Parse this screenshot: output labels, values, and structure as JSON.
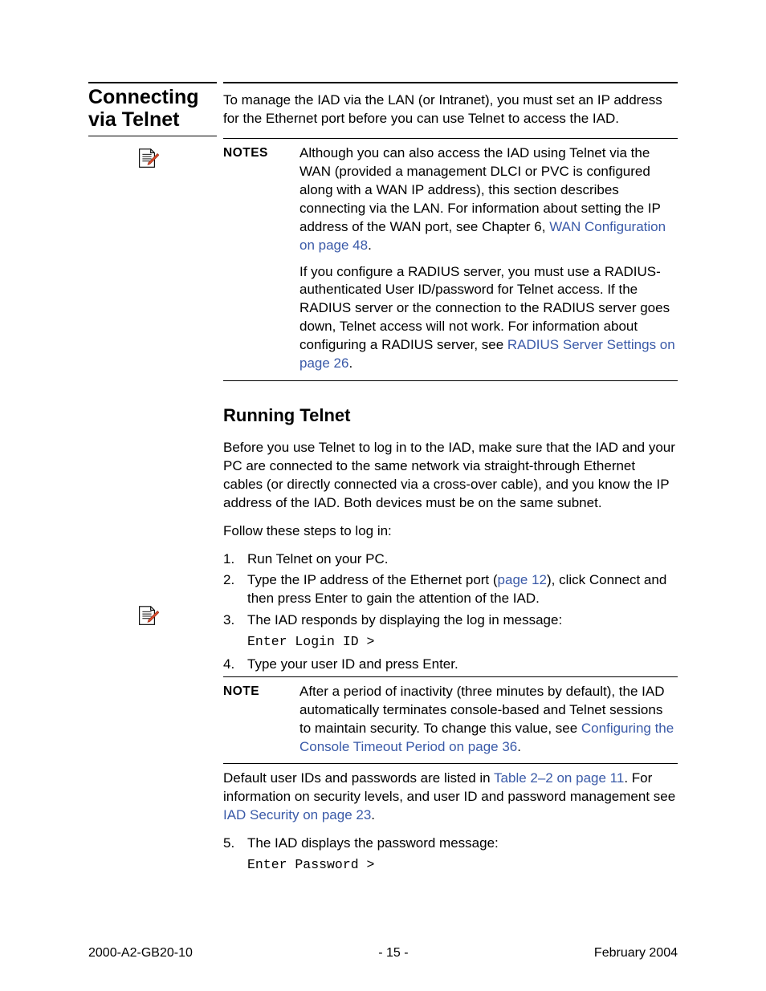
{
  "section_title": "Connecting via Telnet",
  "intro": "To manage the IAD via the LAN (or Intranet), you must set an IP address for the Ethernet port before you can use Telnet to access the IAD.",
  "notes_label": "NOTES",
  "notes": {
    "p1a": "Although you can also access the IAD using Telnet via the WAN (provided a management DLCI or PVC is configured along with a WAN IP address), this section describes connecting via the LAN. For information about setting the IP address of the WAN port, see Chapter 6, ",
    "p1x": "WAN Configuration on page 48",
    "p1b": ".",
    "p2a": "If you configure a RADIUS server, you must use a RADIUS-authenticated User ID/password for Telnet access. If the RADIUS server or the connection to the RADIUS server goes down, Telnet access will not work. For information about configuring a RADIUS server, see ",
    "p2x": "RADIUS Server Settings on page 26",
    "p2b": "."
  },
  "h2": "Running Telnet",
  "before": "Before you use Telnet to log in to the IAD, make sure that the IAD and your PC are connected to the same network via straight-through Ethernet cables (or directly connected via a cross-over cable), and you know the IP address of the IAD. Both devices must be on the same subnet.",
  "follow": "Follow these steps to log in:",
  "steps": {
    "s1n": "1.",
    "s1": "Run Telnet on your PC.",
    "s2n": "2.",
    "s2a": "Type the IP address of the Ethernet port (",
    "s2x": "page 12",
    "s2b": "), click Connect and then press Enter to gain the attention of the IAD.",
    "s3n": "3.",
    "s3": "The IAD responds by displaying the log in message:",
    "code1": "Enter Login ID >",
    "s4n": "4.",
    "s4": "Type your user ID and press Enter."
  },
  "note2_label": "NOTE",
  "note2": {
    "a": "After a period of inactivity (three minutes by default), the IAD automatically terminates console-based and Telnet sessions to maintain security. To change this value, see ",
    "x": "Configuring the Console Timeout Period on page 36",
    "b": "."
  },
  "after_note": {
    "a": "Default user IDs and passwords are listed in ",
    "x1": "Table 2–2 on page 11",
    "b": ". For information on security levels, and user ID and password management see ",
    "x2": "IAD Security on page 23",
    "c": "."
  },
  "steps2": {
    "s5n": "5.",
    "s5": "The IAD displays the password message:",
    "code2": "Enter Password >"
  },
  "footer": {
    "left": "2000-A2-GB20-10",
    "center": "- 15 -",
    "right": "February 2004"
  }
}
